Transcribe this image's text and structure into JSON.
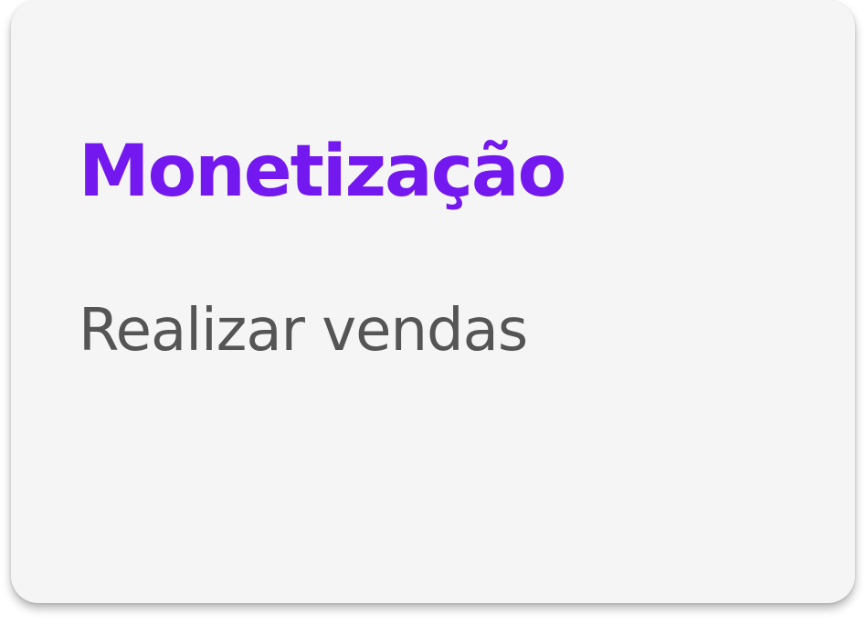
{
  "card": {
    "title": "Monetização",
    "subtitle": "Realizar vendas"
  },
  "colors": {
    "title": "#7418f0",
    "subtitle": "#555555",
    "card_background": "#f5f5f5"
  }
}
